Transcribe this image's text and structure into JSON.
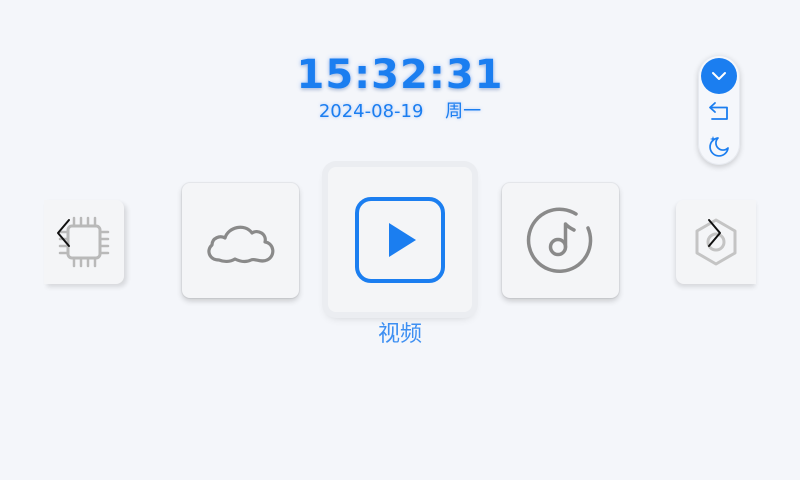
{
  "clock": {
    "time": "15:32:31",
    "date": "2024-08-19",
    "weekday": "周一"
  },
  "controls": {
    "items": [
      "chevron-down-icon",
      "return-icon",
      "night-mode-icon"
    ],
    "accent": "#1b7ef0"
  },
  "carousel": {
    "cards": [
      "chip-icon",
      "cloud-icon",
      "play-icon",
      "music-disc-icon",
      "hexagon-icon"
    ],
    "selected_label": "视频",
    "icon_color": "#8a8a8a",
    "selected_color": "#1b7ef0"
  }
}
